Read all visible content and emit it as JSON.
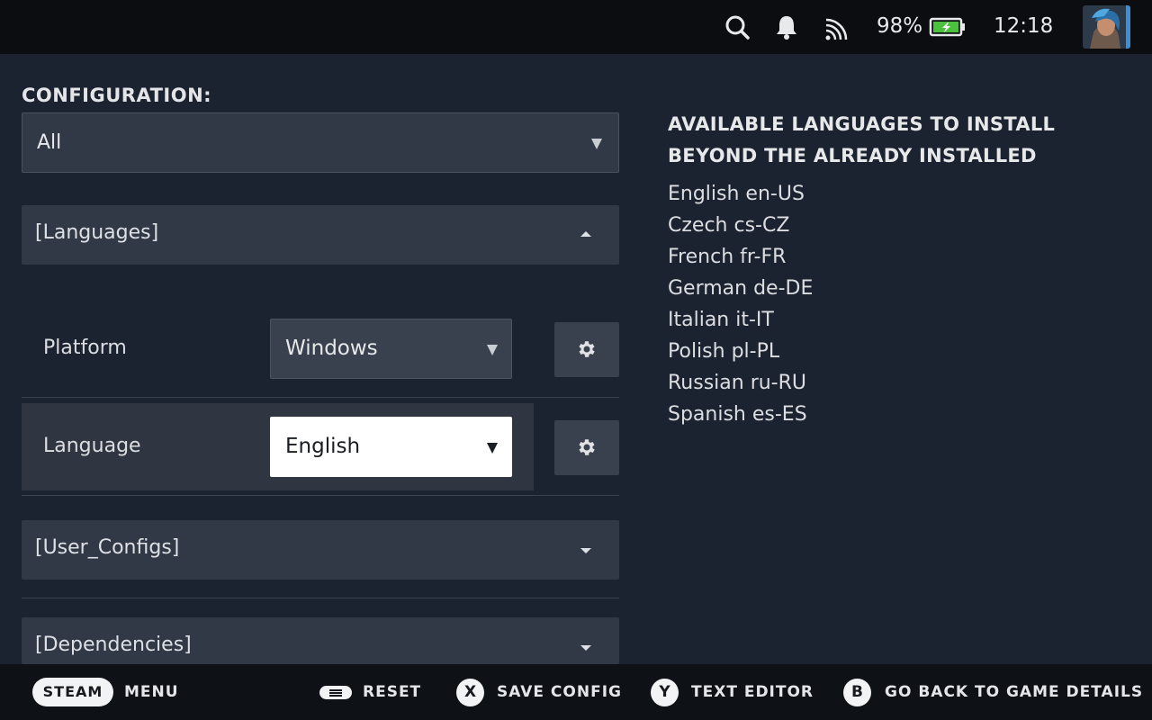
{
  "status_bar": {
    "battery": "98%",
    "time": "12:18"
  },
  "config": {
    "label": "CONFIGURATION:",
    "selected": "All"
  },
  "sections": {
    "languages": "[Languages]",
    "user_configs": "[User_Configs]",
    "dependencies": "[Dependencies]"
  },
  "rows": {
    "platform": {
      "label": "Platform",
      "value": "Windows"
    },
    "language": {
      "label": "Language",
      "value": "English"
    }
  },
  "available": {
    "title": "AVAILABLE LANGUAGES TO INSTALL BEYOND THE ALREADY INSTALLED",
    "languages": [
      "English en-US",
      "Czech cs-CZ",
      "French fr-FR",
      "German de-DE",
      "Italian it-IT",
      "Polish pl-PL",
      "Russian ru-RU",
      "Spanish es-ES"
    ]
  },
  "footer": {
    "steam": "STEAM",
    "menu": "MENU",
    "reset": "RESET",
    "x_key": "X",
    "save": "SAVE CONFIG",
    "y_key": "Y",
    "text_editor": "TEXT EDITOR",
    "b_key": "B",
    "back": "GO BACK TO GAME DETAILS"
  },
  "colors": {
    "background": "#1b2230",
    "panel": "#323946",
    "focus": "#ffffff",
    "battery": "#4cc13e"
  }
}
